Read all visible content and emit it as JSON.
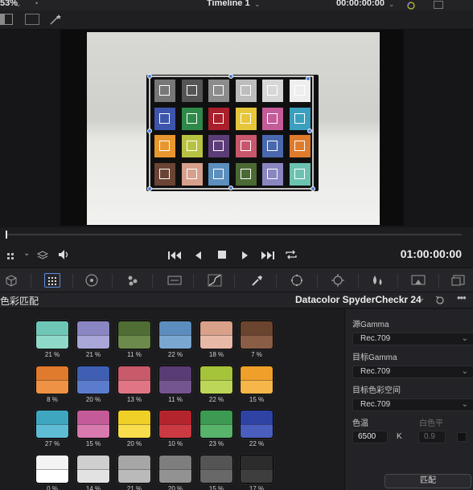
{
  "header": {
    "zoom": "53%",
    "timeline_title": "Timeline 1",
    "timecode": "00:00:00:00"
  },
  "transport": {
    "timecode": "01:00:00:00"
  },
  "panel": {
    "title": "色彩匹配",
    "chart_selector": "Datacolor SpyderCheckr 24"
  },
  "settings": {
    "source_gamma_label": "源Gamma",
    "source_gamma_value": "Rec.709",
    "target_gamma_label": "目标Gamma",
    "target_gamma_value": "Rec.709",
    "target_colorspace_label": "目标色彩空间",
    "target_colorspace_value": "Rec.709",
    "color_temp_label": "色温",
    "color_temp_value": "6500",
    "color_temp_unit": "K",
    "white_level_label": "白色平",
    "white_level_value": "0.9",
    "match_button": "匹配"
  },
  "colors": {
    "accent": "#4a7fd6"
  },
  "swatch_rows": [
    [
      {
        "top": "#6ec7b6",
        "bottom": "#8fd9c9",
        "pct": "21 %"
      },
      {
        "top": "#8a86c4",
        "bottom": "#a9a6d9",
        "pct": "21 %"
      },
      {
        "top": "#4f6d34",
        "bottom": "#6b8a4b",
        "pct": "11 %"
      },
      {
        "top": "#5d8dbe",
        "bottom": "#7aa7d2",
        "pct": "22 %"
      },
      {
        "top": "#d9a08a",
        "bottom": "#e8b9a6",
        "pct": "18 %"
      },
      {
        "top": "#6b4430",
        "bottom": "#8a5d46",
        "pct": "7 %"
      }
    ],
    [
      {
        "top": "#e07a2c",
        "bottom": "#ee9245",
        "pct": "8 %"
      },
      {
        "top": "#3e5fb4",
        "bottom": "#5b7ccd",
        "pct": "20 %"
      },
      {
        "top": "#c95a6a",
        "bottom": "#e07685",
        "pct": "13 %"
      },
      {
        "top": "#5a3c74",
        "bottom": "#74558f",
        "pct": "11 %"
      },
      {
        "top": "#a6c43a",
        "bottom": "#bcd657",
        "pct": "22 %"
      },
      {
        "top": "#ef9f2a",
        "bottom": "#f6b64a",
        "pct": "15 %"
      }
    ],
    [
      {
        "top": "#3fa6c0",
        "bottom": "#5ebdd4",
        "pct": "27 %"
      },
      {
        "top": "#c45a98",
        "bottom": "#d879b0",
        "pct": "15 %"
      },
      {
        "top": "#f0cf26",
        "bottom": "#f8dd4c",
        "pct": "20 %"
      },
      {
        "top": "#b4242d",
        "bottom": "#cb3a43",
        "pct": "10 %"
      },
      {
        "top": "#3d9a52",
        "bottom": "#58b36b",
        "pct": "23 %"
      },
      {
        "top": "#2e43a3",
        "bottom": "#4a5ebd",
        "pct": "22 %"
      }
    ],
    [
      {
        "top": "#f4f4f4",
        "bottom": "#ffffff",
        "pct": "0 %"
      },
      {
        "top": "#cfcfcf",
        "bottom": "#e2e2e2",
        "pct": "14 %"
      },
      {
        "top": "#a6a6a6",
        "bottom": "#bababa",
        "pct": "21 %"
      },
      {
        "top": "#7e7e7e",
        "bottom": "#929292",
        "pct": "20 %"
      },
      {
        "top": "#545454",
        "bottom": "#686868",
        "pct": "15 %"
      },
      {
        "top": "#2c2c2c",
        "bottom": "#3e3e3e",
        "pct": "17 %"
      }
    ]
  ],
  "checker_patches": [
    [
      "#777777",
      "#555555",
      "#8c8c8c",
      "#bdbdbd",
      "#d7d7d7",
      "#eeeeee"
    ],
    [
      "#3d55aa",
      "#2f8a4a",
      "#a91f2b",
      "#e7c63a",
      "#c45c9a",
      "#3aa0bd"
    ],
    [
      "#e8962e",
      "#b8c242",
      "#5d3d78",
      "#c8566c",
      "#4a68ad",
      "#df7b2c"
    ],
    [
      "#6a4434",
      "#d6a08c",
      "#5c8fbd",
      "#4a6a33",
      "#8a86c0",
      "#6cc2b1"
    ]
  ]
}
